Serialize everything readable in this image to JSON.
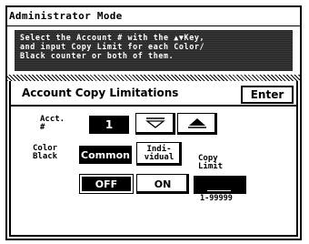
{
  "window": {
    "title": "Administrator Mode"
  },
  "instruction": "Select the Account # with the ▲▼Key,\nand input Copy Limit for each Color/\nBlack counter or both of them.",
  "section": {
    "title": "Account Copy Limitations",
    "enter_label": "Enter"
  },
  "account": {
    "label": "Acct.\n#",
    "value": "1",
    "down_icon": "triangle-down-icon",
    "up_icon": "triangle-up-icon"
  },
  "counter": {
    "label": "Color\nBlack",
    "options": [
      {
        "label": "Common",
        "selected": true
      },
      {
        "label": "Indi-\nvidual",
        "selected": false
      }
    ]
  },
  "limit_toggle": {
    "options": [
      {
        "label": "OFF",
        "selected": true
      },
      {
        "label": "ON",
        "selected": false
      }
    ]
  },
  "copy_limit": {
    "label": "Copy\nLimit",
    "value": "",
    "range": "1-99999"
  },
  "colors": {
    "dark": "#000000",
    "light": "#ffffff",
    "banner": "#3a3a3a"
  }
}
